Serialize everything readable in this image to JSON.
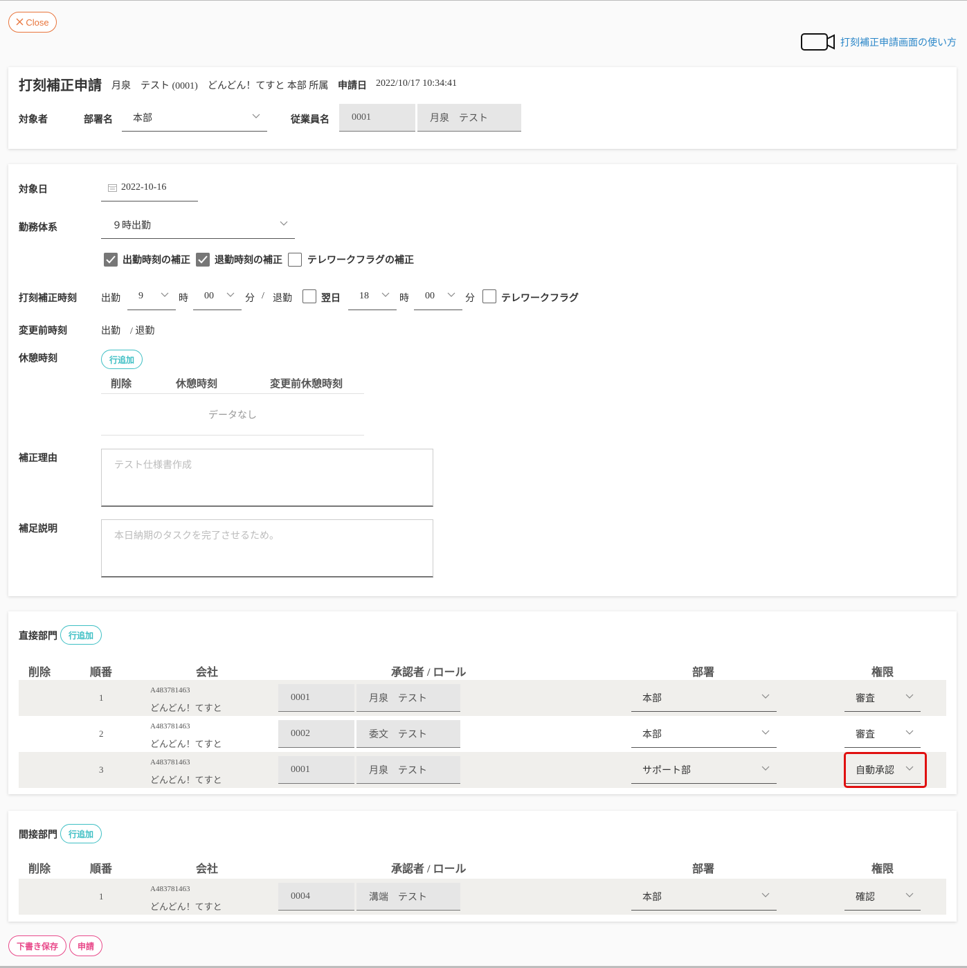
{
  "close_label": "Close",
  "help_link": "打刻補正申請画面の使い方",
  "header": {
    "title": "打刻補正申請",
    "applicant_info": "月泉　テスト (0001)　どんどん！てすと 本部 所属",
    "apply_date_label": "申請日",
    "apply_date": "2022/10/17 10:34:41"
  },
  "target": {
    "label": "対象者",
    "dept_label": "部署名",
    "dept_value": "本部",
    "emp_label": "従業員名",
    "emp_code": "0001",
    "emp_name": "月泉　テスト"
  },
  "form": {
    "date_label": "対象日",
    "date_value": "2022-10-16",
    "work_system_label": "勤務体系",
    "work_system_value": "９時出勤",
    "checks": [
      {
        "label": "出勤時刻の補正",
        "checked": true
      },
      {
        "label": "退勤時刻の補正",
        "checked": true
      },
      {
        "label": "テレワークフラグの補正",
        "checked": false
      }
    ],
    "correction_label": "打刻補正時刻",
    "in_label": "出勤",
    "in_hour": "9",
    "hour_unit": "時",
    "in_min": "00",
    "min_unit": "分",
    "slash": "/",
    "out_label": "退勤",
    "next_day_label": "翌日",
    "out_hour": "18",
    "out_min": "00",
    "telework_label": "テレワークフラグ",
    "before_label": "変更前時刻",
    "before_value": "出勤　/ 退勤",
    "break_label": "休憩時刻",
    "add_row": "行追加",
    "break_cols": [
      "削除",
      "休憩時刻",
      "変更前休憩時刻"
    ],
    "no_data": "データなし",
    "reason_label": "補正理由",
    "reason_placeholder": "テスト仕様書作成",
    "note_label": "補足説明",
    "note_placeholder": "本日納期のタスクを完了させるため。"
  },
  "direct": {
    "title": "直接部門",
    "add_row": "行追加",
    "cols": [
      "削除",
      "順番",
      "会社",
      "承認者 / ロール",
      "部署",
      "権限"
    ],
    "rows": [
      {
        "order": "1",
        "company_code": "A483781463",
        "company": "どんどん！てすと",
        "code": "0001",
        "name": "月泉　テスト",
        "dept": "本部",
        "role": "審査"
      },
      {
        "order": "2",
        "company_code": "A483781463",
        "company": "どんどん！てすと",
        "code": "0002",
        "name": "委文　テスト",
        "dept": "本部",
        "role": "審査"
      },
      {
        "order": "3",
        "company_code": "A483781463",
        "company": "どんどん！てすと",
        "code": "0001",
        "name": "月泉　テスト",
        "dept": "サポート部",
        "role": "自動承認"
      }
    ]
  },
  "indirect": {
    "title": "間接部門",
    "add_row": "行追加",
    "cols": [
      "削除",
      "順番",
      "会社",
      "承認者 / ロール",
      "部署",
      "権限"
    ],
    "rows": [
      {
        "order": "1",
        "company_code": "A483781463",
        "company": "どんどん！てすと",
        "code": "0004",
        "name": "溝端　テスト",
        "dept": "本部",
        "role": "確認"
      }
    ]
  },
  "footer": {
    "draft_save": "下書き保存",
    "submit": "申請"
  },
  "colors": {
    "accent_orange": "#e8743b",
    "teal": "#3ebfc4",
    "pink": "#e84a8a",
    "highlight_red": "#e01010",
    "link_blue": "#2a86c8"
  }
}
